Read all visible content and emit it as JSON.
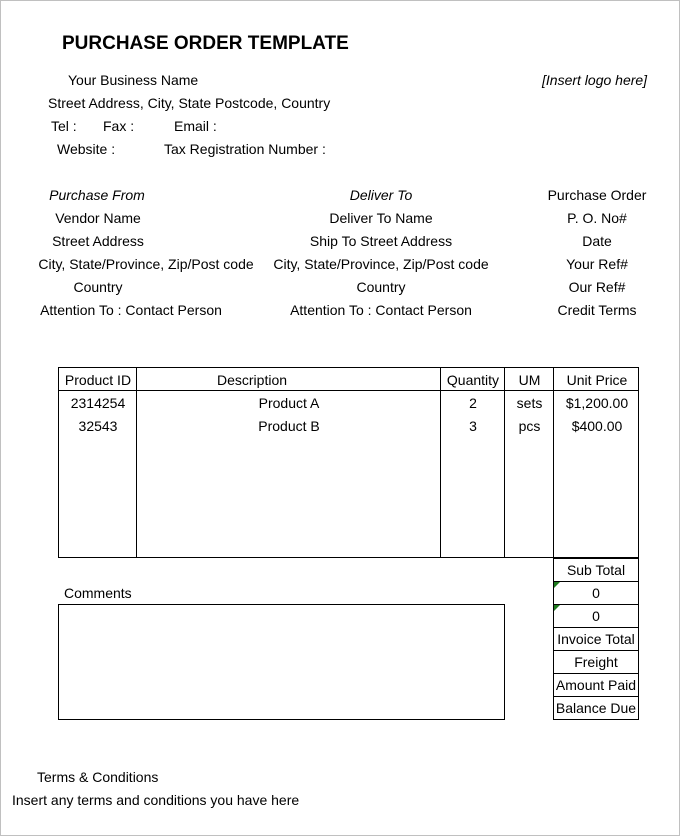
{
  "title": "PURCHASE ORDER TEMPLATE",
  "business": {
    "name": "Your Business Name",
    "logo_placeholder": "[Insert logo here]",
    "address": "Street Address, City, State Postcode, Country",
    "tel_label": "Tel :",
    "fax_label": "Fax :",
    "email_label": "Email :",
    "website_label": "Website :",
    "tax_label": "Tax Registration Number :"
  },
  "purchase_from": {
    "heading": "Purchase From",
    "lines": [
      "Vendor Name",
      "Street Address",
      "City, State/Province, Zip/Post code",
      "Country",
      "Attention To : Contact Person"
    ]
  },
  "deliver_to": {
    "heading": "Deliver To",
    "lines": [
      "Deliver To Name",
      "Ship To Street Address",
      "City, State/Province, Zip/Post code",
      "Country",
      "Attention To : Contact Person"
    ]
  },
  "order_info": {
    "heading": "Purchase Order",
    "lines": [
      "P. O. No#",
      "Date",
      "Your Ref#",
      "Our Ref#",
      "Credit Terms"
    ]
  },
  "items_table": {
    "columns": [
      "Product ID",
      "Description",
      "Quantity",
      "UM",
      "Unit Price"
    ],
    "rows": [
      {
        "product_id": "2314254",
        "description": "Product A",
        "quantity": "2",
        "um": "sets",
        "unit_price": "$1,200.00"
      },
      {
        "product_id": "32543",
        "description": "Product B",
        "quantity": "3",
        "um": "pcs",
        "unit_price": "$400.00"
      }
    ]
  },
  "totals": [
    "Sub Total",
    "0",
    "0",
    "Invoice Total",
    "Freight",
    "Amount Paid",
    "Balance Due"
  ],
  "comments_label": "Comments",
  "terms": {
    "heading": "Terms & Conditions",
    "text": "Insert any terms and conditions you have here"
  }
}
